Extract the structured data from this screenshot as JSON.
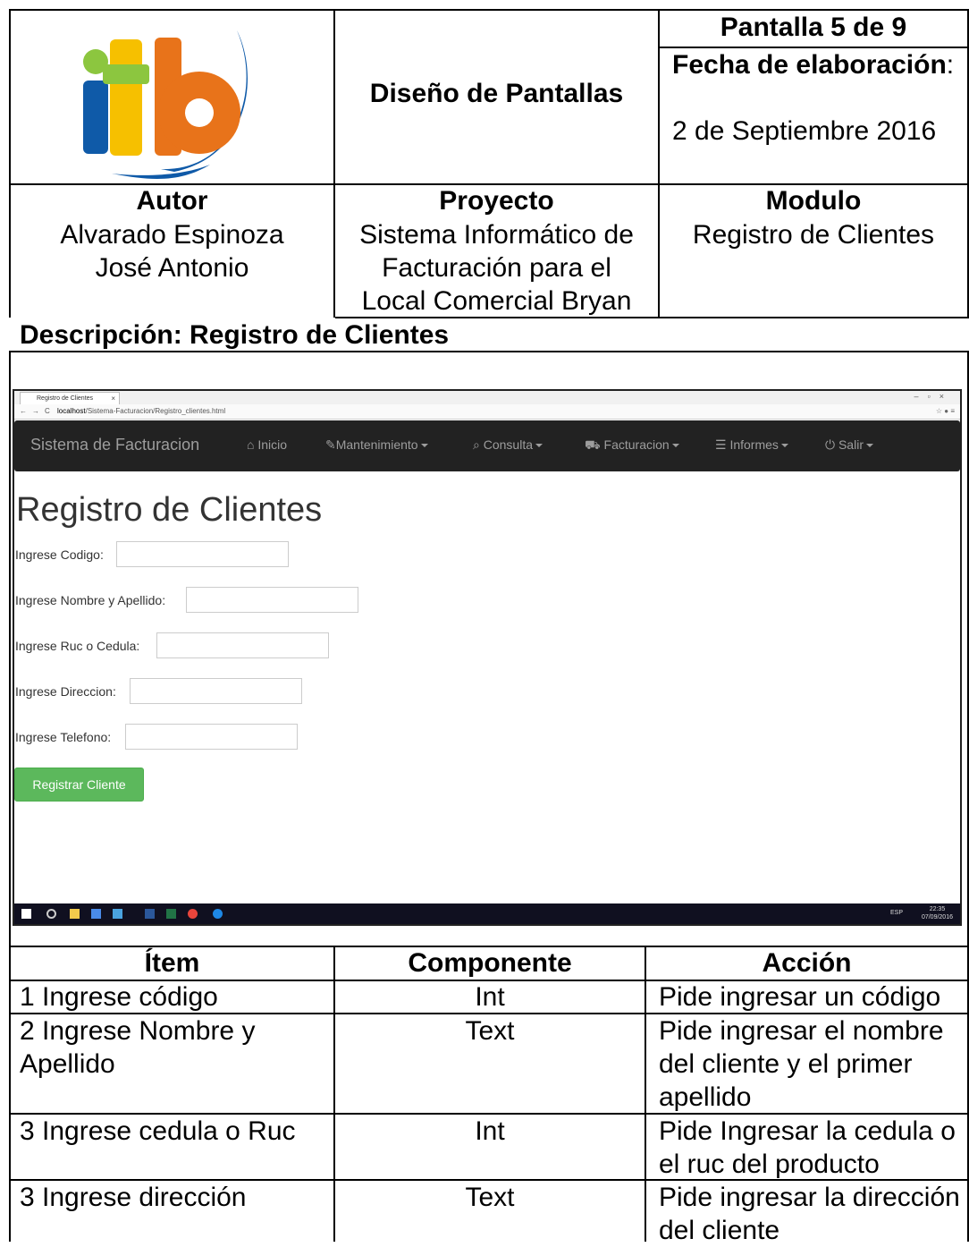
{
  "header": {
    "title": "Diseño de Pantallas",
    "pantalla": "Pantalla 5 de 9",
    "fecha_label": "Fecha de elaboración",
    "fecha_colon": ":",
    "fecha_value": "2 de Septiembre 2016"
  },
  "info": {
    "autor_label": "Autor",
    "autor_line1": "Alvarado Espinoza",
    "autor_line2": "José Antonio",
    "proyecto_label": "Proyecto",
    "proyecto_line1": "Sistema Informático de",
    "proyecto_line2": "Facturación para el",
    "proyecto_line3": "Local Comercial Bryan",
    "modulo_label": "Modulo",
    "modulo_value": "Registro de Clientes"
  },
  "descripcion": "Descripción: Registro de Clientes",
  "browser": {
    "tab_title": "Registro de Clientes",
    "tab_close": "×",
    "url_host": "localhost",
    "url_path": "/Sistema-Facturacion/Registro_clientes.html",
    "nav": {
      "brand": "Sistema de Facturacion",
      "items": [
        "Inicio",
        "Mantenimiento",
        "Consulta",
        "Facturacion",
        "Informes",
        "Salir"
      ]
    },
    "page_title": "Registro de Clientes",
    "fields": [
      "Ingrese Codigo:",
      "Ingrese Nombre y Apellido:",
      "Ingrese Ruc o Cedula:",
      "Ingrese Direccion:",
      "Ingrese Telefono:"
    ],
    "submit": "Registrar Cliente",
    "taskbar": {
      "lang": "ESP",
      "time": "22:35",
      "date": "07/09/2016"
    }
  },
  "table": {
    "headers": [
      "Ítem",
      "Componente",
      "Acción"
    ],
    "rows": [
      {
        "item": "1 Ingrese código",
        "componente": "Int",
        "accion": "Pide ingresar un código"
      },
      {
        "item": "2 Ingrese Nombre y Apellido",
        "componente": "Text",
        "accion": "Pide ingresar el nombre del cliente y el primer apellido"
      },
      {
        "item": "3 Ingrese cedula o Ruc",
        "componente": "Int",
        "accion": "Pide Ingresar la cedula o el ruc del producto"
      },
      {
        "item": "3 Ingrese dirección",
        "componente": "Text",
        "accion": "Pide ingresar la dirección del cliente"
      }
    ]
  },
  "colors": {
    "logo_green": "#8cc63f",
    "logo_yellow": "#f6c000",
    "logo_blue": "#0f5aa8",
    "logo_orange": "#e8731a",
    "navbar": "#222222",
    "button": "#5cb85c"
  }
}
